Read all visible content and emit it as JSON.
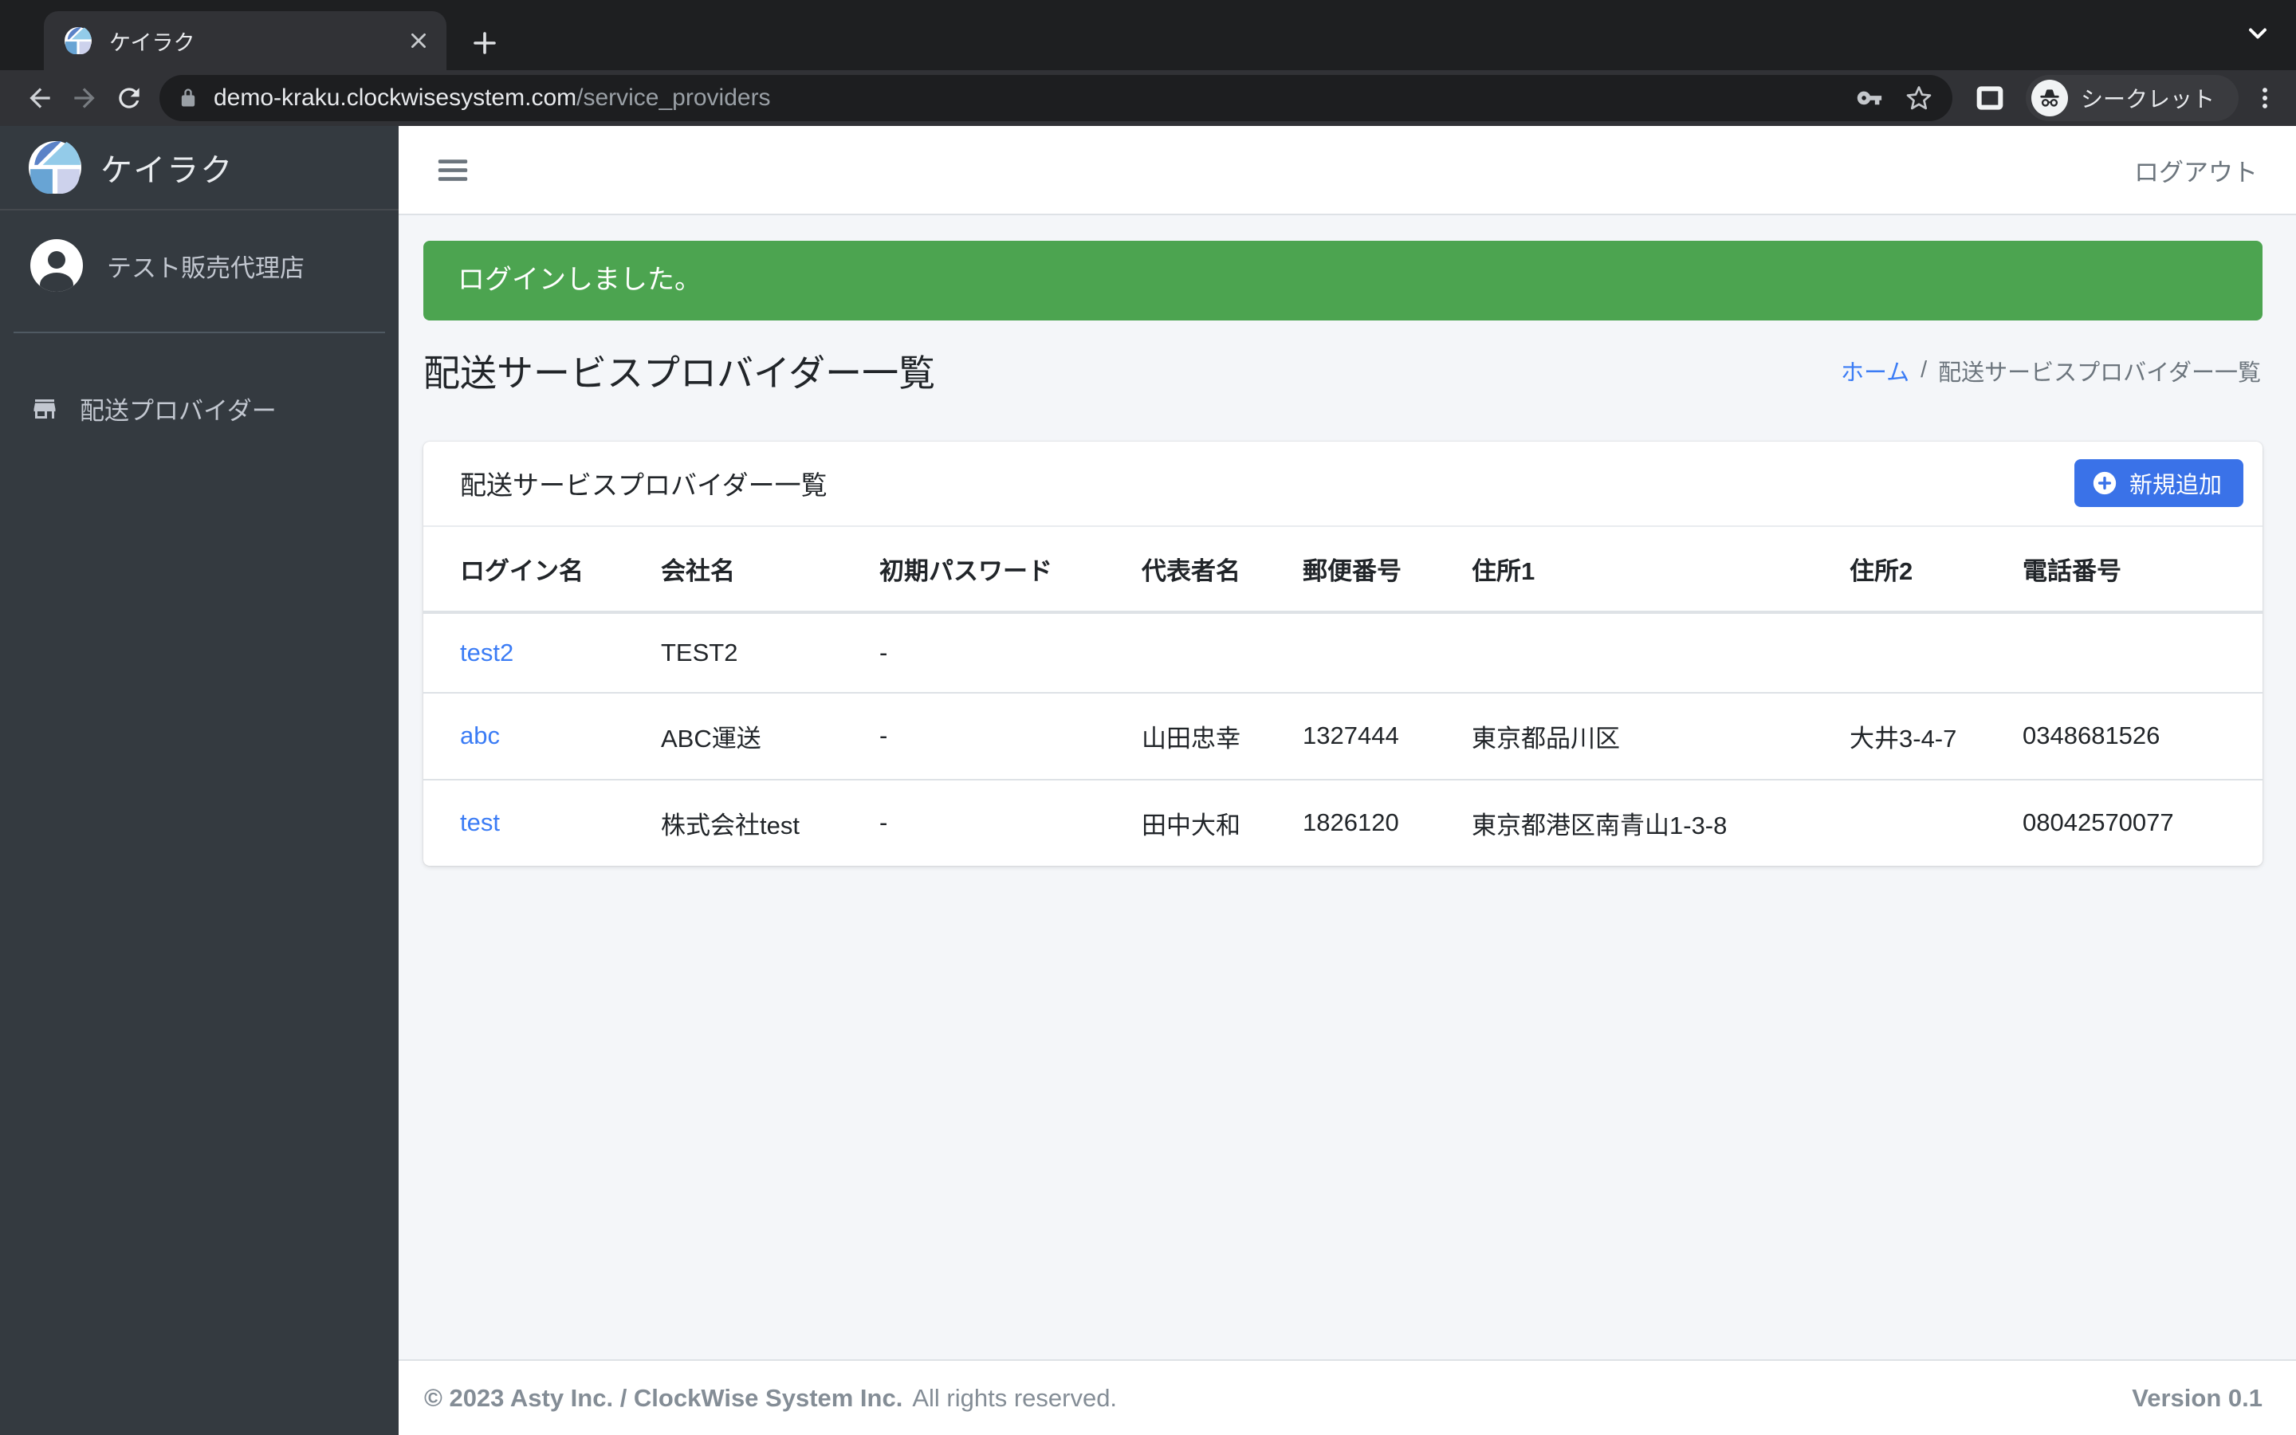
{
  "browser": {
    "tab_title": "ケイラク",
    "url_host": "demo-kraku.clockwisesystem.com",
    "url_path": "/service_providers",
    "incognito_label": "シークレット"
  },
  "sidebar": {
    "brand": "ケイラク",
    "user_name": "テスト販売代理店",
    "menu": [
      {
        "label": "配送プロバイダー"
      }
    ]
  },
  "navbar": {
    "logout_label": "ログアウト"
  },
  "alert": {
    "message": "ログインしました。"
  },
  "page": {
    "title": "配送サービスプロバイダー一覧",
    "breadcrumb": {
      "home": "ホーム",
      "separator": "/",
      "current": "配送サービスプロバイダー一覧"
    }
  },
  "card": {
    "title": "配送サービスプロバイダー一覧",
    "add_button": "新規追加"
  },
  "table": {
    "headers": [
      "ログイン名",
      "会社名",
      "初期パスワード",
      "代表者名",
      "郵便番号",
      "住所1",
      "住所2",
      "電話番号"
    ],
    "rows": [
      [
        "test2",
        "TEST2",
        "-",
        "",
        "",
        "",
        "",
        ""
      ],
      [
        "abc",
        "ABC運送",
        "-",
        "山田忠幸",
        "1327444",
        "東京都品川区",
        "大井3-4-7",
        "0348681526"
      ],
      [
        "test",
        "株式会社test",
        "-",
        "田中大和",
        "1826120",
        "東京都港区南青山1-3-8",
        "",
        "08042570077"
      ]
    ]
  },
  "footer": {
    "copyright_strong": "© 2023 Asty Inc. / ClockWise System Inc.",
    "copyright_rest": "All rights reserved.",
    "version": "Version 0.1"
  },
  "colors": {
    "accent_blue": "#3a72e8",
    "link_blue": "#3b7cf5",
    "success_green": "#4ca450",
    "sidebar_bg": "#343a40",
    "content_bg": "#f4f6f9"
  },
  "icons": {
    "favicon": "quadrant-circle-logo",
    "incognito": "hat-and-glasses",
    "menu_toggle": "hamburger",
    "sidebar_item": "storefront",
    "user": "account-circle",
    "add": "plus-circle"
  }
}
